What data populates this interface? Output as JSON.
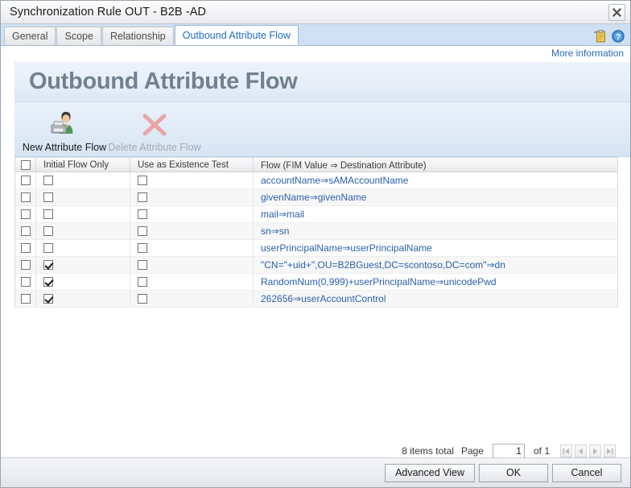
{
  "window": {
    "title": "Synchronization Rule OUT - B2B -AD",
    "close_icon": "close-icon"
  },
  "tabs": [
    {
      "label": "General",
      "active": false
    },
    {
      "label": "Scope",
      "active": false
    },
    {
      "label": "Relationship",
      "active": false
    },
    {
      "label": "Outbound Attribute Flow",
      "active": true
    }
  ],
  "tabstrip_icons": [
    {
      "name": "clipboard-icon"
    },
    {
      "name": "help-icon"
    }
  ],
  "more_information_link": "More information",
  "banner": {
    "title": "Outbound Attribute Flow"
  },
  "toolbar": {
    "new_label": "New Attribute Flow",
    "delete_label": "Delete Attribute Flow",
    "new_icon": "new-user-icon",
    "delete_icon": "red-x-icon"
  },
  "grid": {
    "columns": [
      {
        "key": "select",
        "label": ""
      },
      {
        "key": "initial_flow_only",
        "label": "Initial Flow Only"
      },
      {
        "key": "use_as_existence_test",
        "label": "Use as Existence Test"
      },
      {
        "key": "flow",
        "label": "Flow (FIM Value ⇒ Destination Attribute)"
      }
    ],
    "header_select_all_checked": false,
    "rows": [
      {
        "selected": false,
        "initial_flow_only": false,
        "use_as_existence_test": false,
        "flow": "accountName⇒sAMAccountName"
      },
      {
        "selected": false,
        "initial_flow_only": false,
        "use_as_existence_test": false,
        "flow": "givenName⇒givenName"
      },
      {
        "selected": false,
        "initial_flow_only": false,
        "use_as_existence_test": false,
        "flow": "mail⇒mail"
      },
      {
        "selected": false,
        "initial_flow_only": false,
        "use_as_existence_test": false,
        "flow": "sn⇒sn"
      },
      {
        "selected": false,
        "initial_flow_only": false,
        "use_as_existence_test": false,
        "flow": "userPrincipalName⇒userPrincipalName"
      },
      {
        "selected": false,
        "initial_flow_only": true,
        "use_as_existence_test": false,
        "flow": "\"CN=\"+uid+\",OU=B2BGuest,DC=scontoso,DC=com\"⇒dn"
      },
      {
        "selected": false,
        "initial_flow_only": true,
        "use_as_existence_test": false,
        "flow": "RandomNum(0,999)+userPrincipalName⇒unicodePwd"
      },
      {
        "selected": false,
        "initial_flow_only": true,
        "use_as_existence_test": false,
        "flow": "262656⇒userAccountControl"
      }
    ]
  },
  "pager": {
    "items_total": "8 items total",
    "page_label": "Page",
    "page_value": "1",
    "of_label": "of 1",
    "nav": [
      {
        "name": "first-page-button",
        "enabled": false
      },
      {
        "name": "previous-page-button",
        "enabled": false
      },
      {
        "name": "next-page-button",
        "enabled": false
      },
      {
        "name": "last-page-button",
        "enabled": false
      }
    ]
  },
  "footer": {
    "advanced_view_label": "Advanced View",
    "ok_label": "OK",
    "cancel_label": "Cancel"
  },
  "colors": {
    "tab_active_text": "#1f6fc4",
    "link": "#2d6cb5",
    "flow_text": "#2a5faa",
    "banner_title": "#72808f",
    "tabstrip_bg": "#cfe0f2"
  }
}
